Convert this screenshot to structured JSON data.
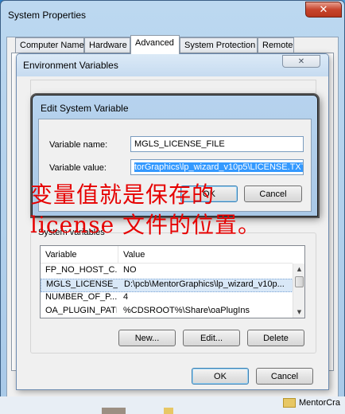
{
  "system_properties": {
    "title": "System Properties",
    "close_glyph": "✕",
    "tabs": [
      {
        "label": "Computer Name",
        "active": false
      },
      {
        "label": "Hardware",
        "active": false
      },
      {
        "label": "Advanced",
        "active": true
      },
      {
        "label": "System Protection",
        "active": false
      },
      {
        "label": "Remote",
        "active": false
      }
    ]
  },
  "environment_variables": {
    "title": "Environment Variables",
    "close_glyph": "✕",
    "system_variables_label": "System variables",
    "list_columns": [
      "Variable",
      "Value"
    ],
    "rows": [
      {
        "variable": "FP_NO_HOST_C...",
        "value": "NO",
        "selected": false
      },
      {
        "variable": "MGLS_LICENSE_...",
        "value": "D:\\pcb\\MentorGraphics\\lp_wizard_v10p...",
        "selected": true
      },
      {
        "variable": "NUMBER_OF_P...",
        "value": "4",
        "selected": false
      },
      {
        "variable": "OA_PLUGIN_PATH",
        "value": "%CDSROOT%\\Share\\oaPlugIns",
        "selected": false
      }
    ],
    "buttons": {
      "new": "New...",
      "edit": "Edit...",
      "delete": "Delete"
    },
    "footer_buttons": {
      "ok": "OK",
      "cancel": "Cancel"
    }
  },
  "edit_dialog": {
    "title": "Edit System Variable",
    "name_label": "Variable name:",
    "name_value": "MGLS_LICENSE_FILE",
    "value_label": "Variable value:",
    "value_value": "torGraphics\\lp_wizard_v10p5\\LICENSE.TXT",
    "ok_label": "OK",
    "cancel_label": "Cancel"
  },
  "annotation": {
    "line1": "变量值就是保存的",
    "line2": "license 文件的位置。",
    "color": "#e60000"
  },
  "desktop": {
    "item_label": "MentorCra"
  },
  "icons": {
    "scroll_up": "▲",
    "scroll_down": "▼"
  }
}
